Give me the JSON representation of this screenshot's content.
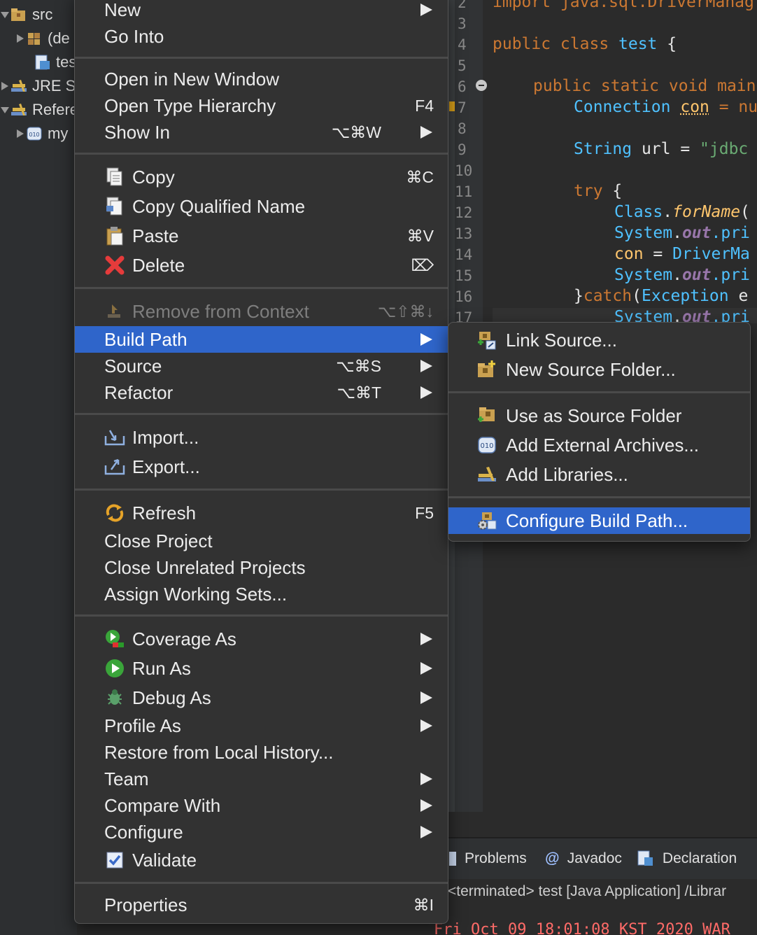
{
  "explorer": {
    "items": [
      {
        "label": "src",
        "indent": 0
      },
      {
        "label": "(de",
        "indent": 1
      },
      {
        "label": "tes",
        "indent": 2
      },
      {
        "label": "JRE S",
        "indent": 0
      },
      {
        "label": "Refere",
        "indent": 0
      },
      {
        "label": "my",
        "indent": 1
      }
    ]
  },
  "editor": {
    "line_numbers": [
      "2",
      "3",
      "4",
      "5",
      "6",
      "7",
      "8",
      "9",
      "10",
      "11",
      "12",
      "13",
      "14",
      "15",
      "16",
      "17"
    ],
    "code": {
      "l2": "import java.sql.DriverManag",
      "l4_kw": "public class ",
      "l4_name": "test",
      "l4_rest": " {",
      "l6": "public static void main",
      "l7_type": "Connection",
      "l7_var": "con",
      "l7_rest": " = nu",
      "l9_type": "String",
      "l9_rest": " url = ",
      "l9_str": "\"jdbc",
      "l11_kw": "try",
      "l11_rest": " {",
      "l12_type": "Class",
      "l12_fn": "forName",
      "l12_rest": "(",
      "l13_type": "System",
      "l13_fd": "out",
      "l13_rest": ".pri",
      "l14_var": "con",
      "l14_rest": " = ",
      "l14_type": "DriverMa",
      "l15_type": "System",
      "l15_fd": "out",
      "l15_rest": ".pri",
      "l16_a": "}",
      "l16_kw": "catch",
      "l16_b": "(",
      "l16_type": "Exception",
      "l16_c": " e",
      "l17_type": "System",
      "l17_fd": "out",
      "l17_rest": ".pri"
    }
  },
  "bottom": {
    "tabs": [
      {
        "label": "Problems",
        "icon": "problems-icon"
      },
      {
        "label": "Javadoc",
        "icon": "javadoc-icon"
      },
      {
        "label": "Declaration",
        "icon": "declaration-icon"
      }
    ],
    "console_title": "<terminated> test [Java Application] /Librar",
    "console_output": "Fri Oct 09 18:01:08 KST 2020 WAR"
  },
  "context_menu": {
    "new": {
      "label": "New"
    },
    "go_into": {
      "label": "Go Into"
    },
    "open_new_window": {
      "label": "Open in New Window"
    },
    "open_type_hierarchy": {
      "label": "Open Type Hierarchy",
      "shortcut": "F4"
    },
    "show_in": {
      "label": "Show In",
      "shortcut": "⌥⌘W"
    },
    "copy": {
      "label": "Copy",
      "shortcut": "⌘C"
    },
    "copy_qualified": {
      "label": "Copy Qualified Name"
    },
    "paste": {
      "label": "Paste",
      "shortcut": "⌘V"
    },
    "delete": {
      "label": "Delete",
      "shortcut": "⌦"
    },
    "remove_from_context": {
      "label": "Remove from Context",
      "shortcut": "⌥⇧⌘↓"
    },
    "build_path": {
      "label": "Build Path"
    },
    "source": {
      "label": "Source",
      "shortcut": "⌥⌘S"
    },
    "refactor": {
      "label": "Refactor",
      "shortcut": "⌥⌘T"
    },
    "import": {
      "label": "Import..."
    },
    "export": {
      "label": "Export..."
    },
    "refresh": {
      "label": "Refresh",
      "shortcut": "F5"
    },
    "close_project": {
      "label": "Close Project"
    },
    "close_unrelated": {
      "label": "Close Unrelated Projects"
    },
    "assign_working_sets": {
      "label": "Assign Working Sets..."
    },
    "coverage_as": {
      "label": "Coverage As"
    },
    "run_as": {
      "label": "Run As"
    },
    "debug_as": {
      "label": "Debug As"
    },
    "profile_as": {
      "label": "Profile As"
    },
    "restore_history": {
      "label": "Restore from Local History..."
    },
    "team": {
      "label": "Team"
    },
    "compare_with": {
      "label": "Compare With"
    },
    "configure": {
      "label": "Configure"
    },
    "validate": {
      "label": "Validate"
    },
    "properties": {
      "label": "Properties",
      "shortcut": "⌘I"
    }
  },
  "build_path_submenu": {
    "link_source": {
      "label": "Link Source..."
    },
    "new_source_folder": {
      "label": "New Source Folder..."
    },
    "use_as_source_folder": {
      "label": "Use as Source Folder"
    },
    "add_external_archives": {
      "label": "Add External Archives..."
    },
    "add_libraries": {
      "label": "Add Libraries..."
    },
    "configure_build_path": {
      "label": "Configure Build Path..."
    }
  },
  "colors": {
    "selection": "#2f65ca",
    "menu_bg": "#323232",
    "keyword": "#cc7832",
    "type": "#4fc1ff"
  }
}
